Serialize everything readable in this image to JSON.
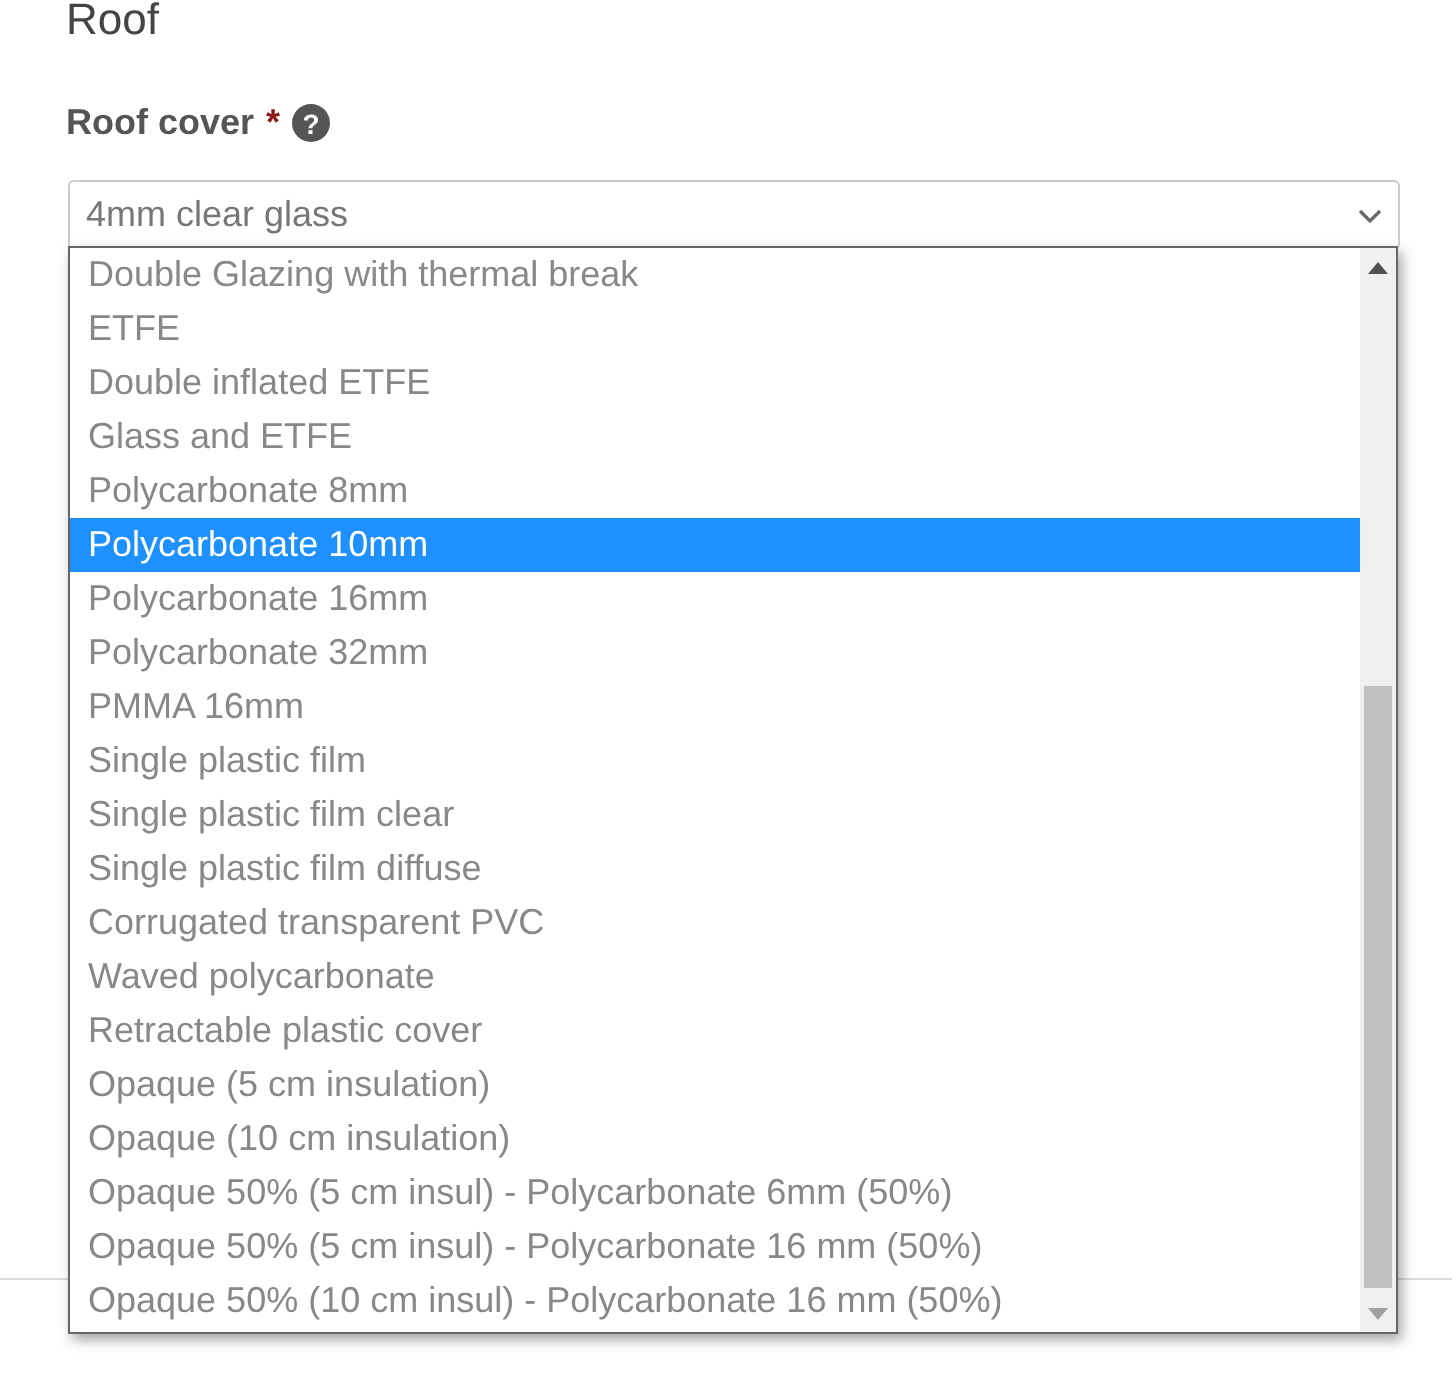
{
  "section_title": "Roof",
  "field": {
    "label": "Roof cover",
    "required_mark": "*",
    "help_icon": "?",
    "value": "4mm clear glass"
  },
  "dropdown": {
    "options": [
      {
        "label": "Double Glazing with thermal break",
        "selected": false
      },
      {
        "label": "ETFE",
        "selected": false
      },
      {
        "label": "Double inflated ETFE",
        "selected": false
      },
      {
        "label": "Glass and ETFE",
        "selected": false
      },
      {
        "label": "Polycarbonate 8mm",
        "selected": false
      },
      {
        "label": "Polycarbonate 10mm",
        "selected": true
      },
      {
        "label": "Polycarbonate 16mm",
        "selected": false
      },
      {
        "label": "Polycarbonate 32mm",
        "selected": false
      },
      {
        "label": "PMMA 16mm",
        "selected": false
      },
      {
        "label": "Single plastic film",
        "selected": false
      },
      {
        "label": "Single plastic film clear",
        "selected": false
      },
      {
        "label": "Single plastic film diffuse",
        "selected": false
      },
      {
        "label": "Corrugated transparent PVC",
        "selected": false
      },
      {
        "label": "Waved polycarbonate",
        "selected": false
      },
      {
        "label": "Retractable plastic cover",
        "selected": false
      },
      {
        "label": "Opaque (5 cm insulation)",
        "selected": false
      },
      {
        "label": "Opaque (10 cm insulation)",
        "selected": false
      },
      {
        "label": "Opaque 50% (5 cm insul) - Polycarbonate 6mm (50%)",
        "selected": false
      },
      {
        "label": "Opaque 50% (5 cm insul) - Polycarbonate 16 mm (50%)",
        "selected": false
      },
      {
        "label": "Opaque 50% (10 cm insul) - Polycarbonate 16 mm (50%)",
        "selected": false
      }
    ]
  }
}
